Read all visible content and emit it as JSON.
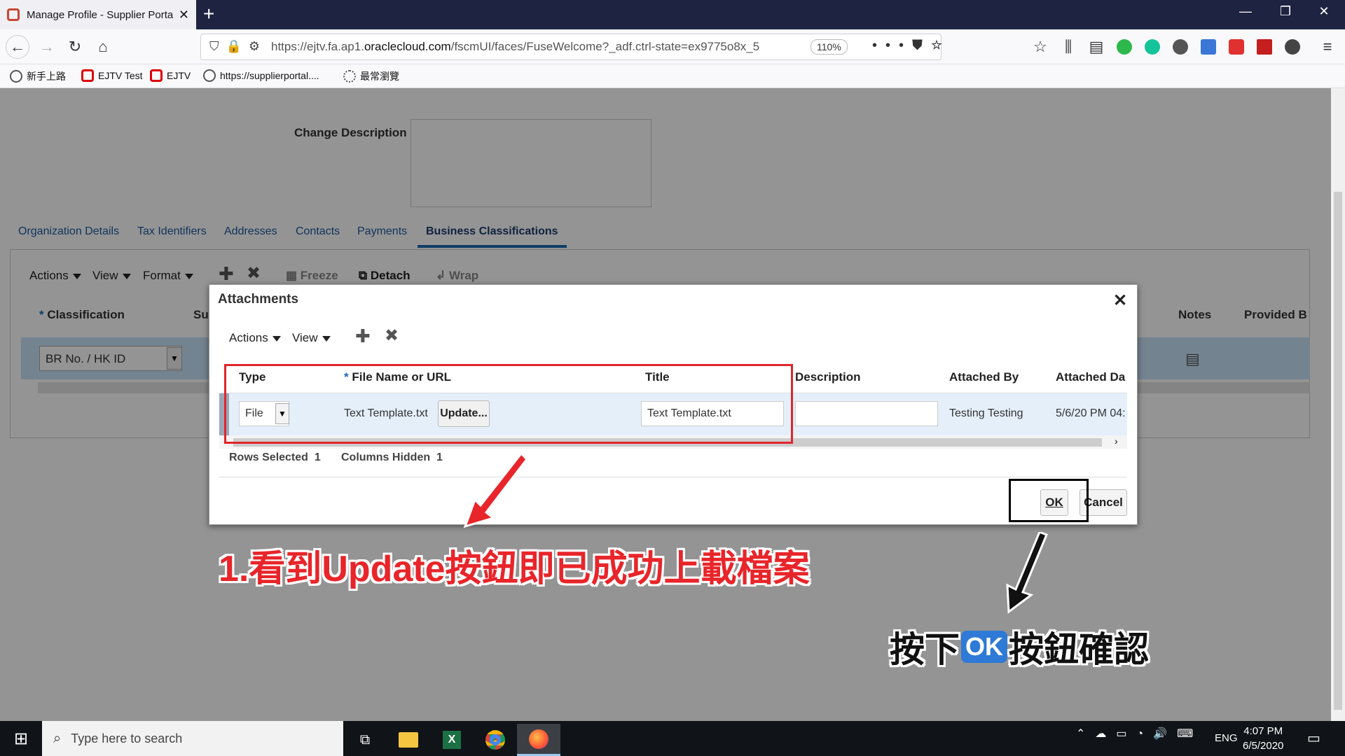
{
  "browser": {
    "tab_title": "Manage Profile - Supplier Porta",
    "url_prefix": "https://ejtv.fa.ap1.",
    "url_domain": "oraclecloud.com",
    "url_rest": "/fscmUI/faces/FuseWelcome?_adf.ctrl-state=ex9775o8x_5",
    "zoom": "110%",
    "bookmarks": [
      "新手上路",
      "EJTV Test",
      "EJTV",
      "https://supplierportal....",
      "最常瀏覽"
    ]
  },
  "page": {
    "change_description_label": "Change Description",
    "tabs": [
      "Organization Details",
      "Tax Identifiers",
      "Addresses",
      "Contacts",
      "Payments",
      "Business Classifications"
    ],
    "toolbar": {
      "actions": "Actions",
      "view": "View",
      "format": "Format",
      "freeze": "Freeze",
      "detach": "Detach",
      "wrap": "Wrap"
    },
    "columns": {
      "required_mark": "*",
      "classification": "Classification",
      "su": "Su",
      "notes": "Notes",
      "provided_by": "Provided B"
    },
    "classification_value": "BR No. / HK ID"
  },
  "dialog": {
    "title": "Attachments",
    "actions": "Actions",
    "view": "View",
    "headers": {
      "type": "Type",
      "required_mark": "*",
      "file_name": "File Name or URL",
      "title": "Title",
      "description": "Description",
      "attached_by": "Attached By",
      "attached_date": "Attached Da"
    },
    "row": {
      "type": "File",
      "file_name": "Text Template.txt",
      "update_button": "Update...",
      "title": "Text Template.txt",
      "description": "",
      "attached_by": "Testing Testing",
      "attached_date": "5/6/20 PM 04:"
    },
    "rows_selected_label": "Rows Selected",
    "rows_selected_value": "1",
    "columns_hidden_label": "Columns Hidden",
    "columns_hidden_value": "1",
    "ok_label": "OK",
    "cancel_label": "Cancel"
  },
  "annotations": {
    "note1": "1.看到Update按鈕即已成功上載檔案",
    "note2_prefix": "按下",
    "note2_badge": "OK",
    "note2_suffix": "按鈕確認"
  },
  "taskbar": {
    "search_placeholder": "Type here to search",
    "language": "ENG",
    "time": "4:07 PM",
    "date": "6/5/2020"
  },
  "colors": {
    "annotation_red": "#e8252a",
    "selected_row": "#c9e2f8",
    "tab_active": "#1b6ab0"
  }
}
